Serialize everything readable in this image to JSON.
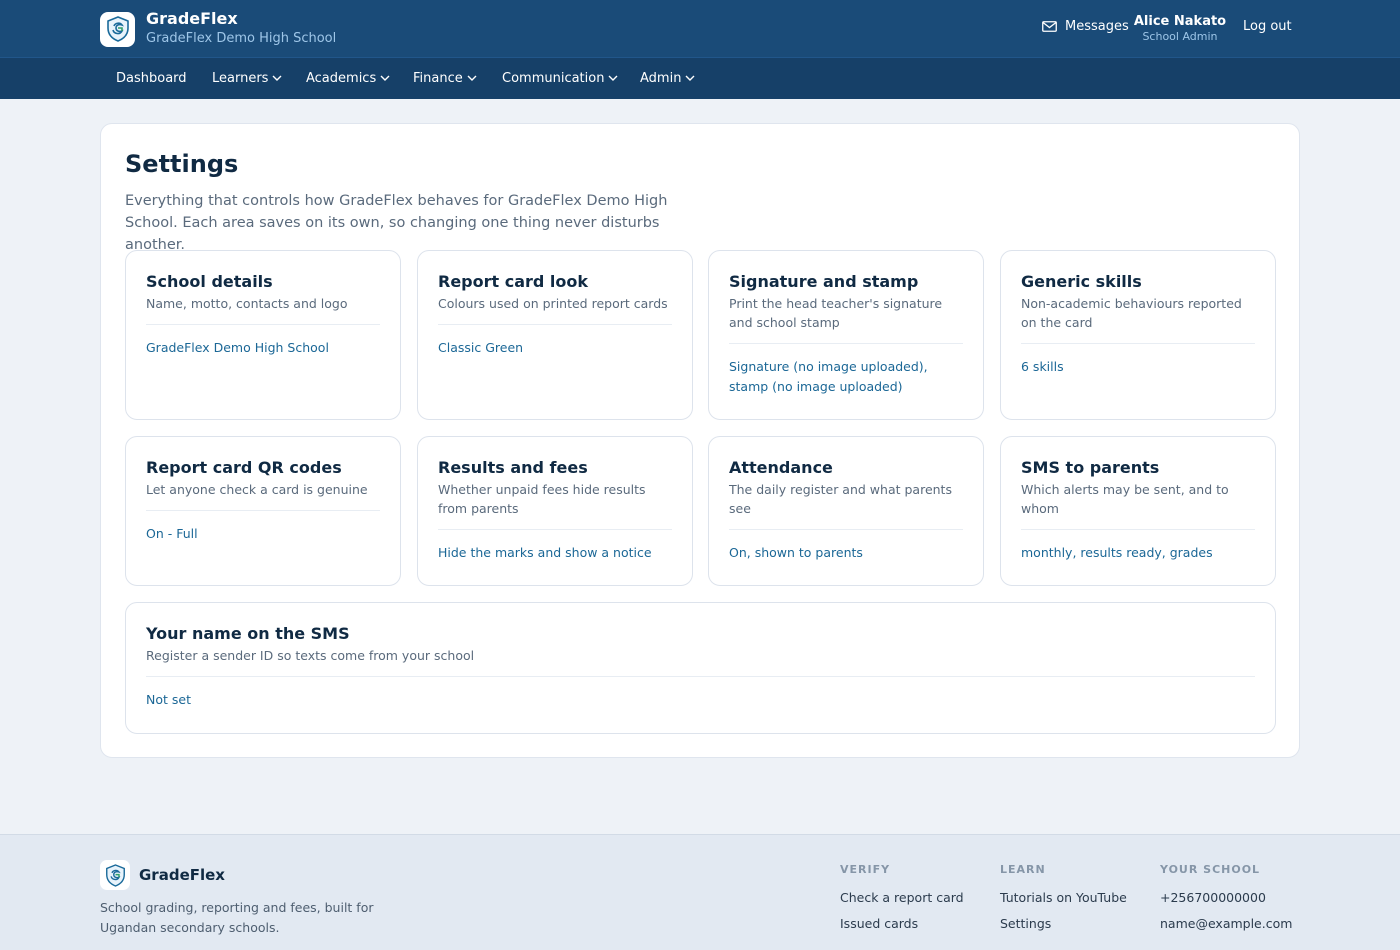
{
  "app": {
    "name": "GradeFlex",
    "school": "GradeFlex Demo High School"
  },
  "header": {
    "messages_label": "Messages",
    "user_name": "Alice Nakato",
    "user_role": "School Admin",
    "logout_label": "Log out"
  },
  "nav": {
    "items": [
      {
        "label": "Dashboard"
      },
      {
        "label": "Learners"
      },
      {
        "label": "Academics"
      },
      {
        "label": "Finance"
      },
      {
        "label": "Communication"
      },
      {
        "label": "Admin"
      }
    ]
  },
  "page": {
    "title": "Settings",
    "intro": "Everything that controls how GradeFlex behaves for GradeFlex Demo High School. Each area saves on its own, so changing one thing never disturbs another."
  },
  "tiles": [
    {
      "title": "School details",
      "desc": "Name, motto, contacts and logo",
      "value": "GradeFlex Demo High School"
    },
    {
      "title": "Report card look",
      "desc": "Colours used on printed report cards",
      "value": "Classic Green"
    },
    {
      "title": "Signature and stamp",
      "desc": "Print the head teacher's signature and school stamp",
      "value": "Signature (no image uploaded), stamp (no image uploaded)"
    },
    {
      "title": "Generic skills",
      "desc": "Non-academic behaviours reported on the card",
      "value": "6 skills"
    },
    {
      "title": "Report card QR codes",
      "desc": "Let anyone check a card is genuine",
      "value": "On - Full"
    },
    {
      "title": "Results and fees",
      "desc": "Whether unpaid fees hide results from parents",
      "value": "Hide the marks and show a notice"
    },
    {
      "title": "Attendance",
      "desc": "The daily register and what parents see",
      "value": "On, shown to parents"
    },
    {
      "title": "SMS to parents",
      "desc": "Which alerts may be sent, and to whom",
      "value": "monthly, results ready, grades"
    },
    {
      "title": "Your name on the SMS",
      "desc": "Register a sender ID so texts come from your school",
      "value": "Not set"
    }
  ],
  "footer": {
    "brand": "GradeFlex",
    "tagline": "School grading, reporting and fees, built for Ugandan secondary schools.",
    "columns": [
      {
        "heading": "VERIFY",
        "links": [
          "Check a report card",
          "Issued cards"
        ]
      },
      {
        "heading": "LEARN",
        "links": [
          "Tutorials on YouTube",
          "Settings"
        ]
      },
      {
        "heading": "YOUR SCHOOL",
        "links": [
          "+256700000000",
          "name@example.com"
        ]
      }
    ]
  },
  "colors": {
    "header_bg": "#1a4b78",
    "nav_bg": "#164068",
    "accent_link": "#1b6796",
    "page_bg": "#eef2f7"
  },
  "icons": {
    "logo": "shield-logo-icon",
    "messages": "envelope-icon",
    "dropdown": "chevron-down-icon"
  }
}
